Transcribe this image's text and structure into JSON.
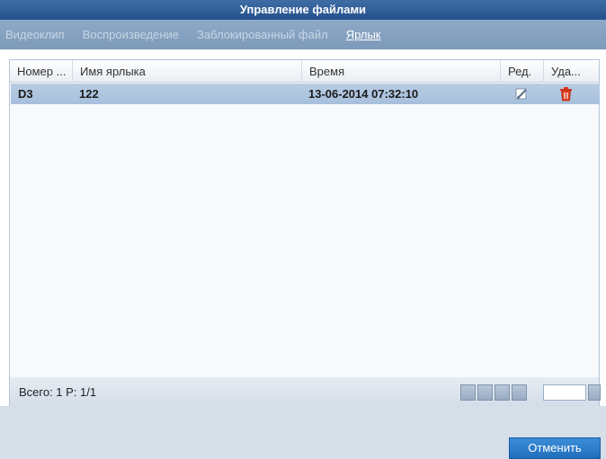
{
  "window": {
    "title": "Управление файлами"
  },
  "tabs": [
    {
      "label": "Видеоклип",
      "active": false
    },
    {
      "label": "Воспроизведение",
      "active": false
    },
    {
      "label": "Заблокированный файл",
      "active": false
    },
    {
      "label": "Ярлык",
      "active": true
    }
  ],
  "table": {
    "columns": [
      "Номер ...",
      "Имя ярлыка",
      "Время",
      "Ред.",
      "Уда..."
    ],
    "rows": [
      {
        "number": "D3",
        "name": "122",
        "time": "13-06-2014 07:32:10",
        "edit_icon": "edit-icon",
        "delete_icon": "trash-icon"
      }
    ]
  },
  "status": {
    "text": "Всего: 1 P: 1/1"
  },
  "pager": {
    "icons": [
      "first-page-icon",
      "prev-page-icon",
      "next-page-icon",
      "last-page-icon"
    ]
  },
  "footer": {
    "cancel_label": "Отменить"
  },
  "colors": {
    "title_bar": "#24508a",
    "selected_row": "#a7bfdc",
    "accent_button": "#1f6ebd",
    "delete_icon": "#d9351c"
  }
}
